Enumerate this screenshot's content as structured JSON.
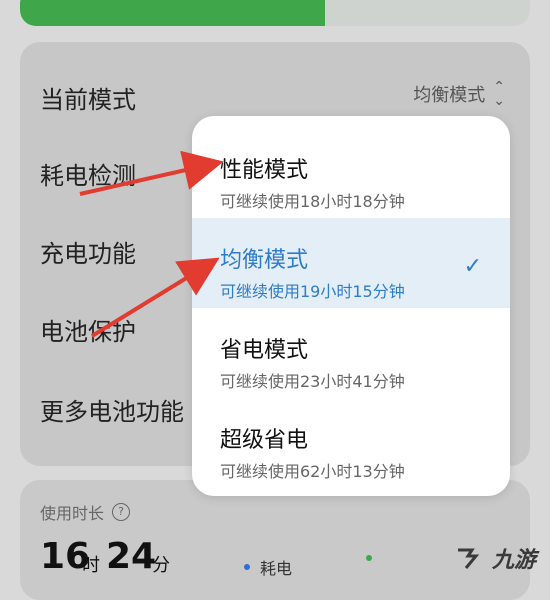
{
  "settings": {
    "current_mode_label": "当前模式",
    "current_mode_value": "均衡模式",
    "items": [
      {
        "label": "耗电检测"
      },
      {
        "label": "充电功能"
      },
      {
        "label": "电池保护"
      },
      {
        "label": "更多电池功能"
      }
    ]
  },
  "usage": {
    "title": "使用时长",
    "hours": "16",
    "hours_unit": "时",
    "minutes": "24",
    "minutes_unit": "分",
    "legend_power": "耗电"
  },
  "popup": {
    "options": [
      {
        "name": "性能模式",
        "sub": "可继续使用18小时18分钟",
        "selected": false
      },
      {
        "name": "均衡模式",
        "sub": "可继续使用19小时15分钟",
        "selected": true
      },
      {
        "name": "省电模式",
        "sub": "可继续使用23小时41分钟",
        "selected": false
      },
      {
        "name": "超级省电",
        "sub": "可继续使用62小时13分钟",
        "selected": false
      }
    ]
  },
  "colors": {
    "accent_blue": "#2f7cc7",
    "arrow_red": "#e23b2f",
    "bar_green": "#3fa64a"
  },
  "icons": {
    "check": "check-icon",
    "chevron": "chevron-up-down-icon",
    "help": "help-circle-icon"
  },
  "watermark": {
    "text": "九游"
  }
}
